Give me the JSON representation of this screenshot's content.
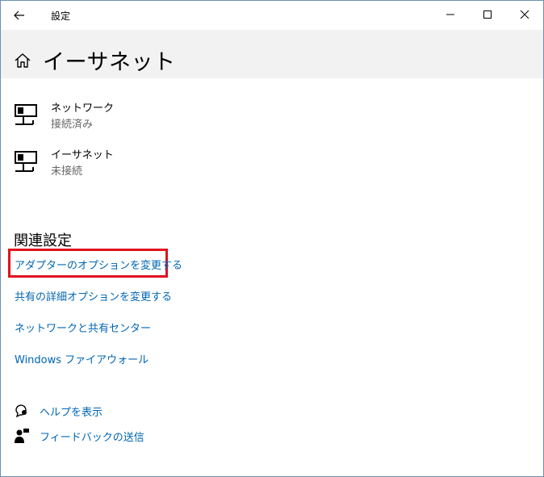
{
  "window": {
    "title": "設定",
    "back_icon": "arrow-left-icon",
    "minimize_icon": "minimize-icon",
    "maximize_icon": "maximize-icon",
    "close_icon": "close-icon"
  },
  "header": {
    "home_icon": "home-icon",
    "page_title": "イーサネット"
  },
  "networks": [
    {
      "icon": "ethernet-icon",
      "name": "ネットワーク",
      "status": "接続済み"
    },
    {
      "icon": "ethernet-icon",
      "name": "イーサネット",
      "status": "未接続"
    }
  ],
  "related": {
    "title": "関連設定",
    "links": [
      "アダプターのオプションを変更する",
      "共有の詳細オプションを変更する",
      "ネットワークと共有センター",
      "Windows ファイアウォール"
    ],
    "highlight_color": "#e0121e"
  },
  "help": [
    {
      "icon": "help-chat-icon",
      "label": "ヘルプを表示"
    },
    {
      "icon": "feedback-icon",
      "label": "フィードバックの送信"
    }
  ],
  "colors": {
    "link": "#0066b4",
    "header_bg": "#f2f2f2"
  }
}
